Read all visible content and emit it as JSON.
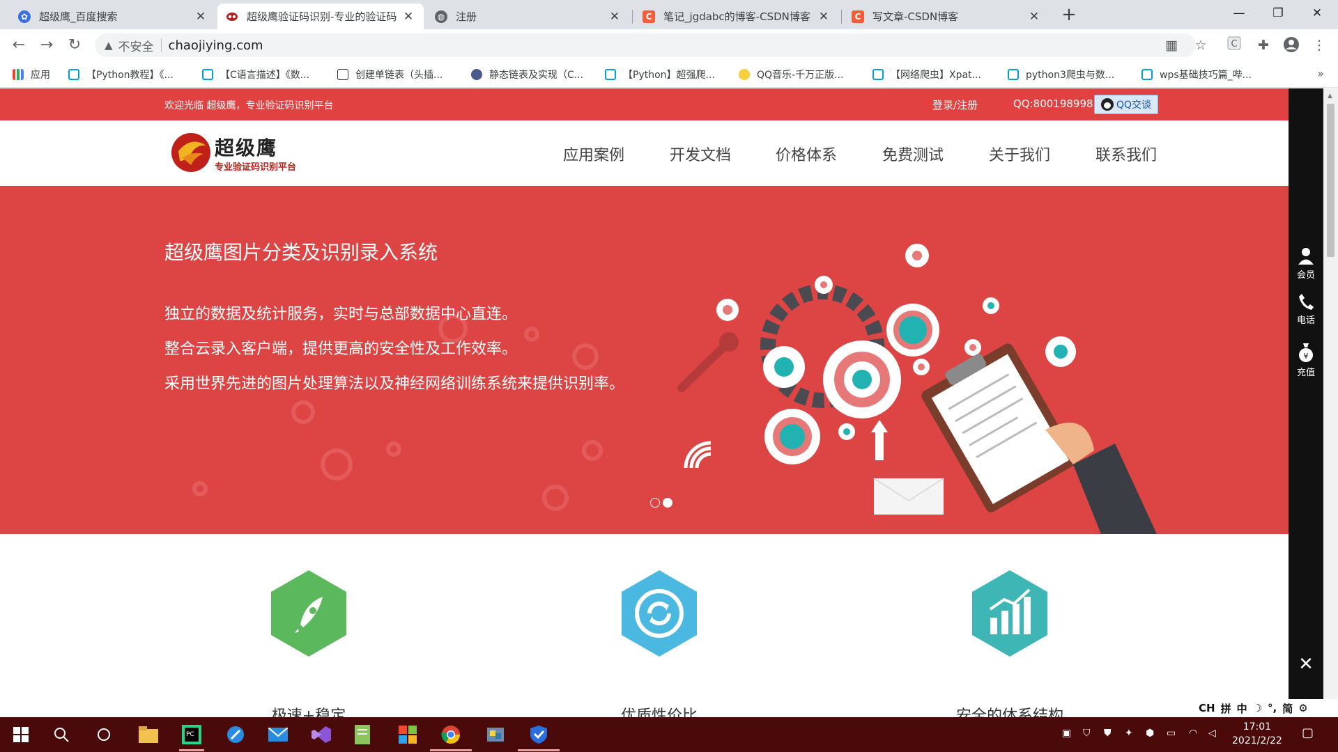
{
  "browser": {
    "tabs": [
      {
        "title": "超级鹰_百度搜索",
        "favicon": "baidu-paw-icon",
        "active": false
      },
      {
        "title": "超级鹰验证码识别-专业的验证码",
        "favicon": "chaojiying-logo-icon",
        "active": true
      },
      {
        "title": "注册",
        "favicon": "globe-icon",
        "active": false
      },
      {
        "title": "笔记_jgdabc的博客-CSDN博客",
        "favicon": "csdn-icon",
        "active": false
      },
      {
        "title": "写文章-CSDN博客",
        "favicon": "csdn-icon",
        "active": false
      }
    ],
    "security_label": "不安全",
    "url": "chaojiying.com",
    "bookmarks": [
      "应用",
      "【Python教程】《...",
      "【C语言描述】《数...",
      "创建单链表（头插...",
      "静态链表及实现（C...",
      "【Python】超强爬...",
      "QQ音乐-千万正版...",
      "【网络爬虫】Xpat...",
      "python3爬虫与数...",
      "wps基础技巧篇_哔..."
    ]
  },
  "site": {
    "topbar": {
      "welcome": "欢迎光临 超级鹰，专业验证码识别平台",
      "login": "登录/注册",
      "qq": "QQ:800198998",
      "qq_chat": "QQ交谈"
    },
    "logo": {
      "name": "超级鹰",
      "tagline": "专业验证码识别平台"
    },
    "nav": [
      "应用案例",
      "开发文档",
      "价格体系",
      "免费测试",
      "关于我们",
      "联系我们"
    ],
    "banner": {
      "heading": "超级鹰图片分类及识别录入系统",
      "lines": [
        "独立的数据及统计服务，实时与总部数据中心直连。",
        "整合云录入客户端，提供更高的安全性及工作效率。",
        "采用世界先进的图片处理算法以及神经网络训练系统来提供识别率。"
      ],
      "slides": 2,
      "active_slide": 2
    },
    "features": [
      {
        "title": "极速+稳定",
        "icon": "rocket-icon",
        "color": "#5cb85c"
      },
      {
        "title": "优质性价比",
        "icon": "refresh-icon",
        "color": "#4ab8e0"
      },
      {
        "title": "安全的体系结构",
        "icon": "bar-chart-icon",
        "color": "#3fb6b6"
      }
    ],
    "sidebar": [
      {
        "label": "会员",
        "icon": "user-icon"
      },
      {
        "label": "电话",
        "icon": "phone-icon"
      },
      {
        "label": "充值",
        "icon": "money-bag-icon"
      }
    ]
  },
  "ime": [
    "CH",
    "拼",
    "中",
    "简"
  ],
  "clock": {
    "time": "17:01",
    "date": "2021/2/22"
  },
  "colors": {
    "brand_red": "#e14141",
    "banner_red": "#dd4444",
    "taskbar": "#4b0a0a"
  }
}
